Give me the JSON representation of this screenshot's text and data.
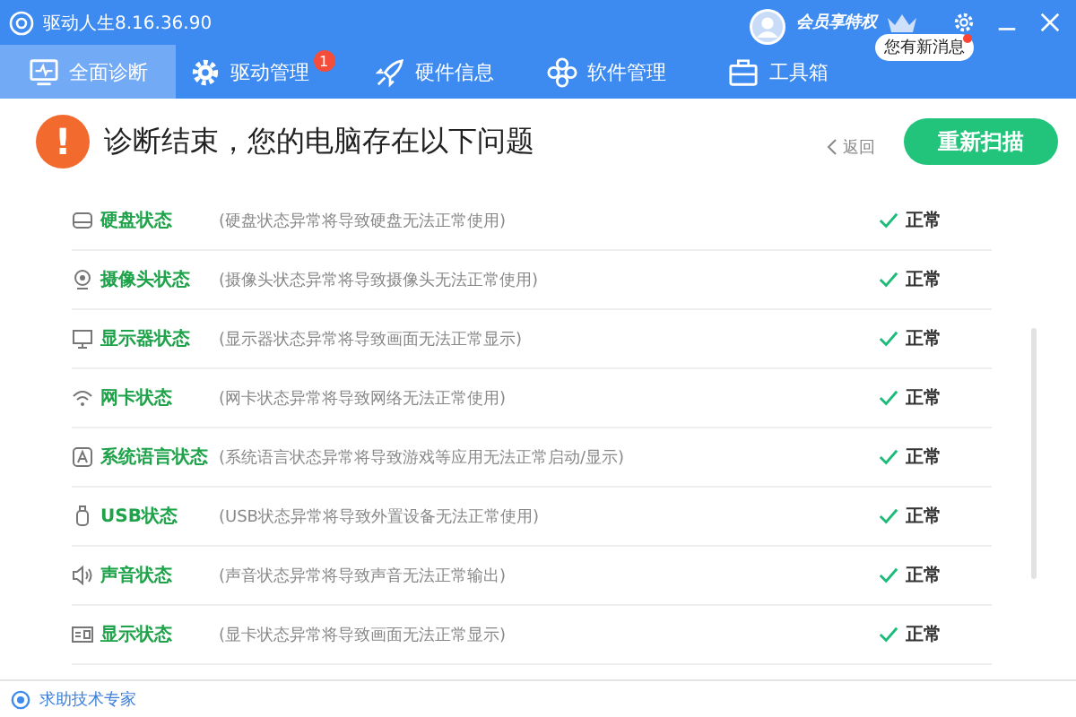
{
  "window": {
    "title": "驱动人生8.16.36.90"
  },
  "account": {
    "vip_label": "会员享特权",
    "message_tip": "您有新消息",
    "message_unread": true
  },
  "tabs": [
    {
      "label": "全面诊断",
      "selected": true
    },
    {
      "label": "驱动管理",
      "selected": false,
      "badge": "1"
    },
    {
      "label": "硬件信息",
      "selected": false
    },
    {
      "label": "软件管理",
      "selected": false
    },
    {
      "label": "工具箱",
      "selected": false
    }
  ],
  "header": {
    "alert_mark": "!",
    "title": "诊断结束，您的电脑存在以下问题",
    "back_link": "返回",
    "rescan_button": "重新扫描"
  },
  "checks": [
    {
      "label": "硬盘状态",
      "description": "(硬盘状态异常将导致硬盘无法正常使用)",
      "status": "正常",
      "ok": true
    },
    {
      "label": "摄像头状态",
      "description": "(摄像头状态异常将导致摄像头无法正常使用)",
      "status": "正常",
      "ok": true
    },
    {
      "label": "显示器状态",
      "description": "(显示器状态异常将导致画面无法正常显示)",
      "status": "正常",
      "ok": true
    },
    {
      "label": "网卡状态",
      "description": "(网卡状态异常将导致网络无法正常使用)",
      "status": "正常",
      "ok": true
    },
    {
      "label": "系统语言状态",
      "description": "(系统语言状态异常将导致游戏等应用无法正常启动/显示)",
      "status": "正常",
      "ok": true
    },
    {
      "label": "USB状态",
      "description": "(USB状态异常将导致外置设备无法正常使用)",
      "status": "正常",
      "ok": true
    },
    {
      "label": "声音状态",
      "description": "(声音状态异常将导致声音无法正常输出)",
      "status": "正常",
      "ok": true
    },
    {
      "label": "显示状态",
      "description": "(显卡状态异常将导致画面无法正常显示)",
      "status": "正常",
      "ok": true
    }
  ],
  "footer": {
    "help_link": "求助技术专家"
  }
}
